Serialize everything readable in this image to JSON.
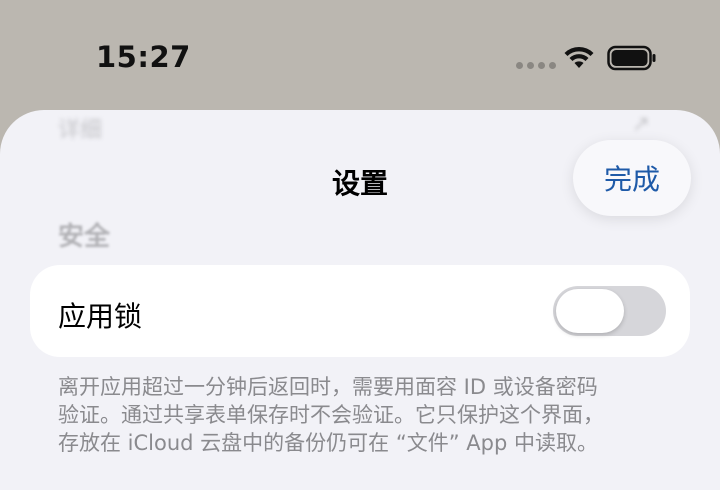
{
  "status_bar": {
    "time": "15:27"
  },
  "sheet": {
    "title": "设置",
    "done_label": "完成",
    "ghost_top_left": "详细",
    "ghost_top_right": "↗",
    "section_header": "安全",
    "app_lock": {
      "label": "应用锁",
      "enabled": false
    },
    "footnote_lines": [
      "离开应用超过一分钟后返回时，需要用面容 ID 或设备密码",
      "验证。通过共享表单保存时不会验证。它只保护这个界面，",
      "存放在 iCloud 云盘中的备份仍可在 “文件” App 中读取。"
    ]
  },
  "colors": {
    "accent": "#1e5aa8",
    "sheet_bg": "#f2f2f7",
    "backdrop": "#bbb7b0"
  }
}
